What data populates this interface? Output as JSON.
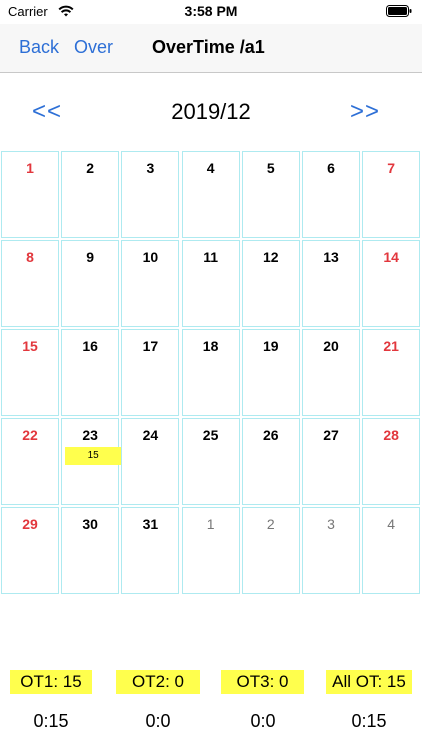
{
  "status_bar": {
    "carrier": "Carrier",
    "time": "3:58 PM"
  },
  "nav": {
    "back": "Back",
    "over": "Over",
    "title": "OverTime /a1"
  },
  "calendar": {
    "prev": "<<",
    "next": ">>",
    "month": "2019/12",
    "weeks": [
      [
        "1",
        "2",
        "3",
        "4",
        "5",
        "6",
        "7"
      ],
      [
        "8",
        "9",
        "10",
        "11",
        "12",
        "13",
        "14"
      ],
      [
        "15",
        "16",
        "17",
        "18",
        "19",
        "20",
        "21"
      ],
      [
        "22",
        "23",
        "24",
        "25",
        "26",
        "27",
        "28"
      ],
      [
        "29",
        "30",
        "31",
        "1",
        "2",
        "3",
        "4"
      ]
    ],
    "ot_badge": "15"
  },
  "summary": [
    {
      "label": "OT1: 15",
      "value": "0:15"
    },
    {
      "label": "OT2: 0",
      "value": "0:0"
    },
    {
      "label": "OT3: 0",
      "value": "0:0"
    },
    {
      "label": "All OT: 15",
      "value": "0:15"
    }
  ],
  "colors": {
    "accent": "#2d6fd6",
    "weekend": "#e2373d",
    "highlight": "#ffff4d",
    "grid": "#aeeaf0"
  }
}
